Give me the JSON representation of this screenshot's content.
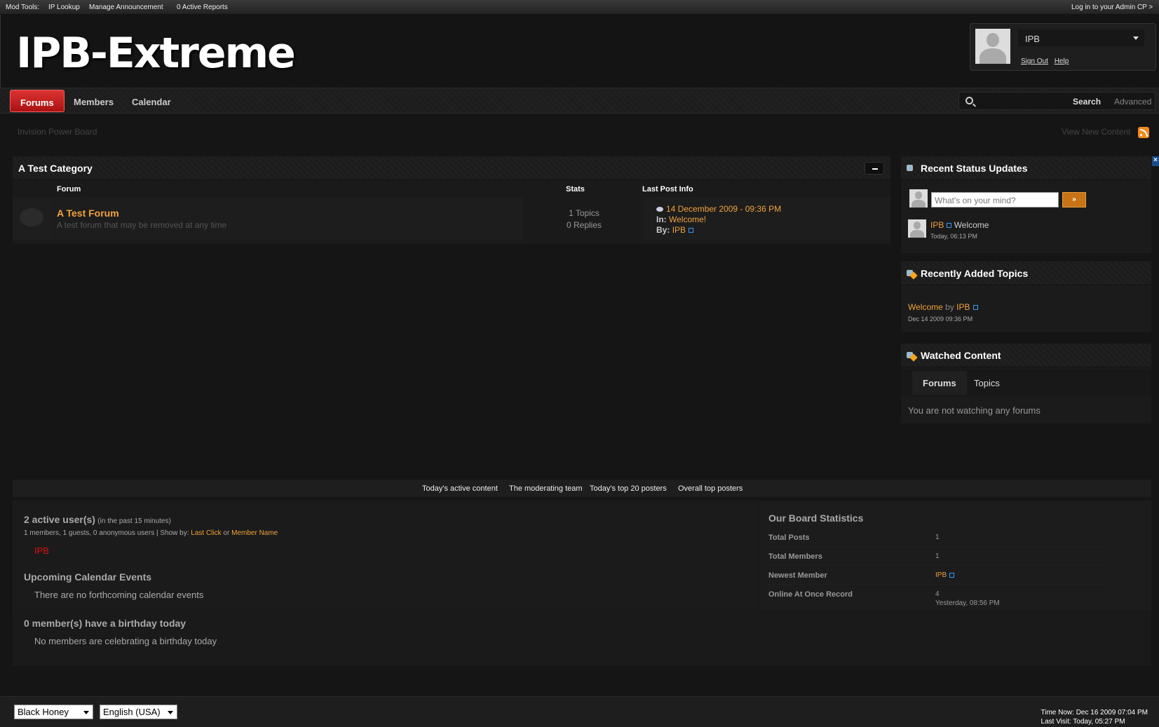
{
  "topbar": {
    "mod_tools": "Mod Tools:",
    "ip_lookup": "IP Lookup",
    "manage_announcement": "Manage Announcement",
    "active_reports": "0 Active Reports",
    "admin_cp": "Log in to your Admin CP >"
  },
  "header": {
    "logo": "IPB-Extreme",
    "user": {
      "name": "IPB",
      "sign_out": "Sign Out",
      "help": "Help"
    }
  },
  "nav": {
    "tabs": [
      "Forums",
      "Members",
      "Calendar"
    ],
    "active_tab": "Forums",
    "search_button": "Search",
    "advanced": "Advanced"
  },
  "breadcrumb": "Invision Power Board",
  "view_new_content": "View New Content",
  "category": {
    "title": "A Test Category",
    "columns": [
      "Forum",
      "Stats",
      "Last Post Info"
    ],
    "forums": [
      {
        "name": "A Test Forum",
        "description": "A test forum that may be removed at any time",
        "topics": "1 Topics",
        "replies": "0 Replies",
        "last_date": "14 December 2009 - 09:36 PM",
        "in_label": "In:",
        "in_topic": "Welcome!",
        "by_label": "By:",
        "by_user": "IPB"
      }
    ]
  },
  "sidebar": {
    "status": {
      "title": "Recent Status Updates",
      "placeholder": "What's on your mind?",
      "submit": "»",
      "items": [
        {
          "user": "IPB",
          "text": "Welcome",
          "time": "Today, 06:13 PM"
        }
      ]
    },
    "recent_topics": {
      "title": "Recently Added Topics",
      "items": [
        {
          "topic": "Welcome",
          "by": "by",
          "user": "IPB",
          "date": "Dec 14 2009 09:36 PM"
        }
      ]
    },
    "watched": {
      "title": "Watched Content",
      "tabs": [
        "Forums",
        "Topics"
      ],
      "active_tab": "Forums",
      "empty": "You are not watching any forums"
    }
  },
  "stats_links": [
    "Today's active content",
    "The moderating team",
    "Today's top 20 posters",
    "Overall top posters"
  ],
  "active_users": {
    "heading": "2 active user(s)",
    "window": "(in the past 15 minutes)",
    "breakdown": "1 members, 1 guests, 0 anonymous users | Show by:",
    "sort_last_click": "Last Click",
    "or": "or",
    "sort_member_name": "Member Name",
    "online": [
      "IPB"
    ]
  },
  "calendar": {
    "heading": "Upcoming Calendar Events",
    "text": "There are no forthcoming calendar events"
  },
  "birthdays": {
    "heading": "0 member(s) have a birthday today",
    "text": "No members are celebrating a birthday today"
  },
  "board_stats": {
    "heading": "Our Board Statistics",
    "rows": [
      {
        "label": "Total Posts",
        "value": "1"
      },
      {
        "label": "Total Members",
        "value": "1"
      },
      {
        "label": "Newest Member",
        "value": "IPB"
      },
      {
        "label": "Online At Once Record",
        "value": "4",
        "sub": "Yesterday, 08:56 PM"
      }
    ]
  },
  "footer": {
    "skin": "Black Honey",
    "language": "English (USA)",
    "time_now": "Time Now: Dec 16 2009 07:04 PM",
    "last_visit": "Last Visit: Today, 05:27 PM"
  },
  "colors": {
    "accent": "#f0a23a",
    "active_tab": "#cc2222",
    "online_user": "#dd1111",
    "background": "#151515"
  }
}
